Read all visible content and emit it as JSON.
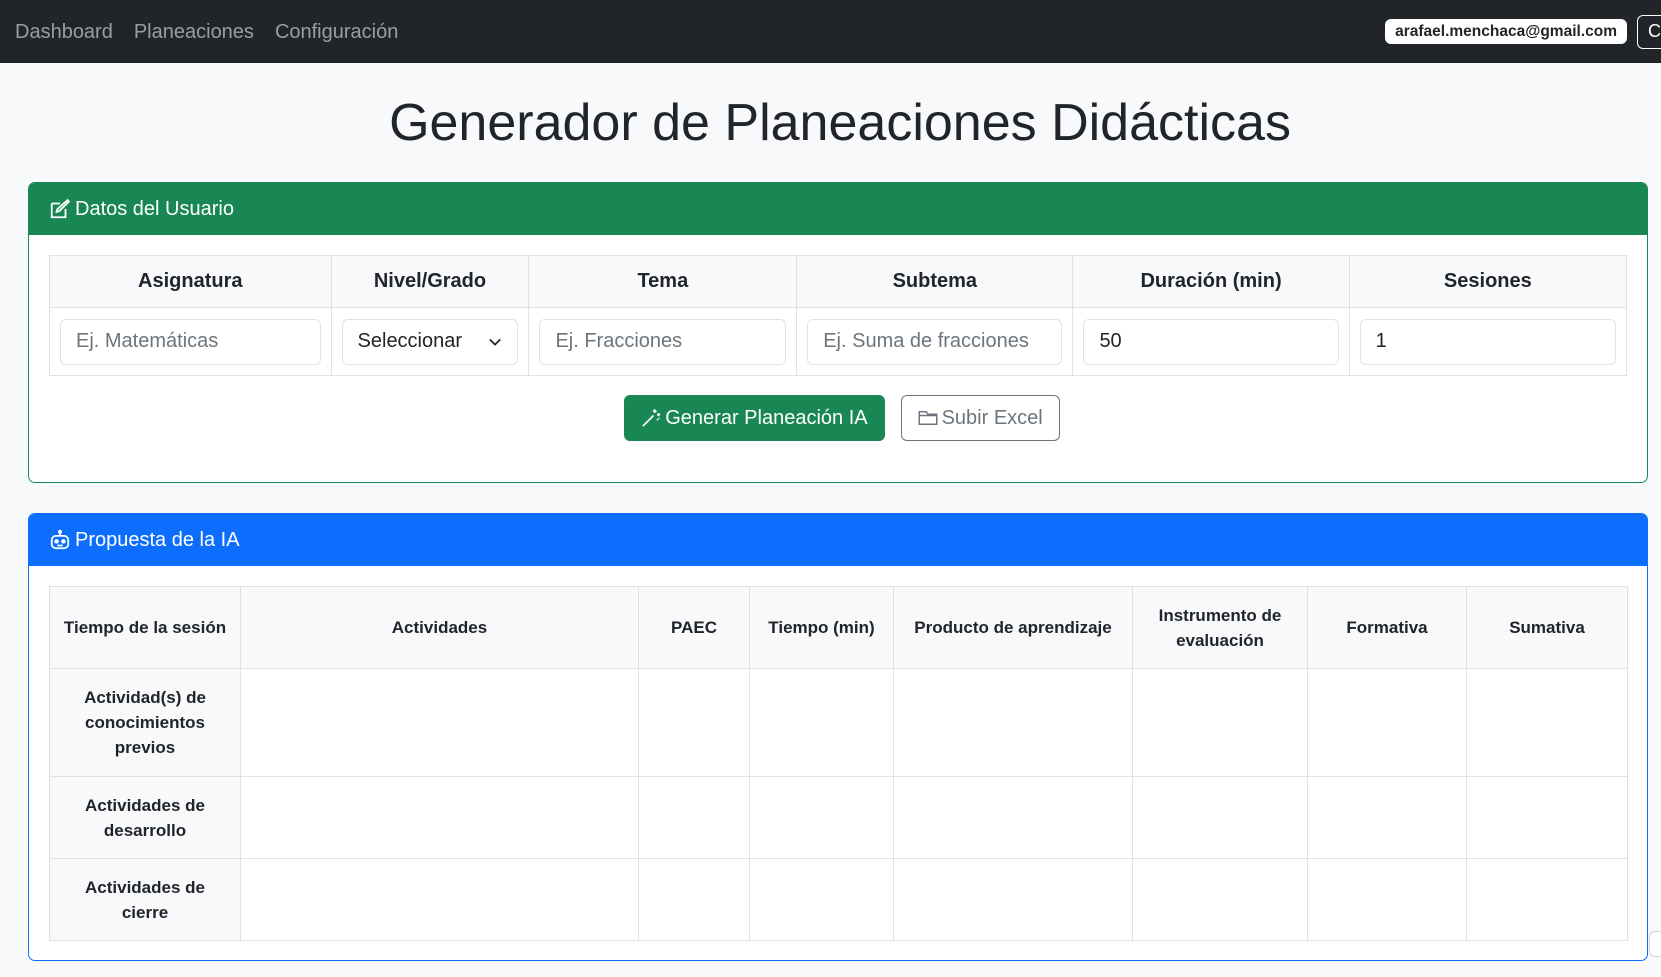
{
  "nav": {
    "links": [
      "Dashboard",
      "Planeaciones",
      "Configuración"
    ],
    "user_email": "arafael.menchaca@gmail.com",
    "logout_label": "C"
  },
  "page_title": "Generador de Planeaciones Didácticas",
  "user_card": {
    "header": "Datos del Usuario",
    "columns": [
      "Asignatura",
      "Nivel/Grado",
      "Tema",
      "Subtema",
      "Duración (min)",
      "Sesiones"
    ],
    "fields": {
      "asignatura_placeholder": "Ej. Matemáticas",
      "nivel_selected": "Seleccionar",
      "tema_placeholder": "Ej. Fracciones",
      "subtema_placeholder": "Ej. Suma de fracciones",
      "duracion_value": "50",
      "sesiones_value": "1"
    },
    "buttons": {
      "generate": "Generar Planeación IA",
      "upload": "Subir Excel"
    }
  },
  "ai_card": {
    "header": "Propuesta de la IA",
    "columns": [
      "Tiempo de la sesión",
      "Actividades",
      "PAEC",
      "Tiempo (min)",
      "Producto de aprendizaje",
      "Instrumento de evaluación",
      "Formativa",
      "Sumativa"
    ],
    "rows": [
      "Actividad(s) de conocimientos previos",
      "Actividades de desarrollo",
      "Actividades de cierre"
    ]
  },
  "colors": {
    "navbar": "#212529",
    "success": "#198754",
    "primary": "#0d6efd"
  },
  "icons": {
    "user_card_header": "pencil-square-icon",
    "ai_card_header": "robot-icon",
    "generate_button": "magic-wand-icon",
    "upload_button": "folder-icon",
    "select": "chevron-down-icon"
  }
}
